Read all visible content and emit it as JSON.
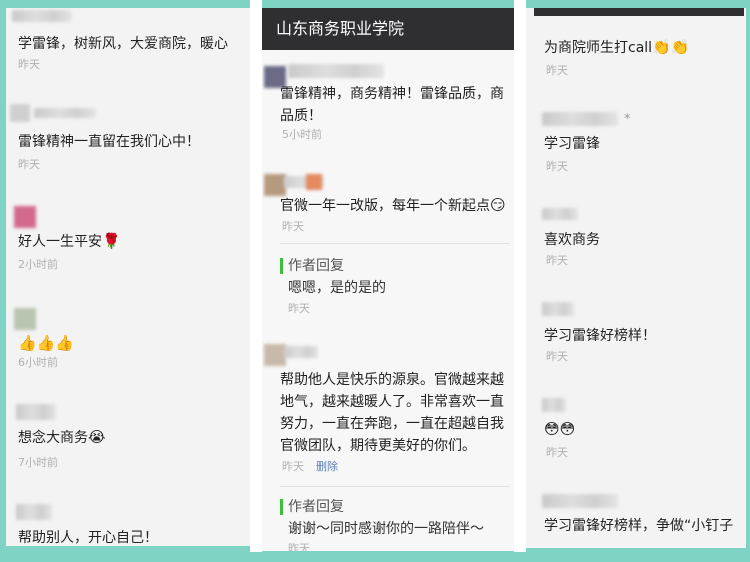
{
  "left_panel": {
    "comments": [
      {
        "text": "学雷锋，树新风，大爱商院，暖心",
        "time": "昨天"
      },
      {
        "text": "雷锋精神一直留在我们心中！",
        "time": "昨天"
      },
      {
        "text": "好人一生平安",
        "emoji": "🌹",
        "time": "2小时前"
      },
      {
        "text": "",
        "emoji": "👍👍👍",
        "time": "6小时前"
      },
      {
        "text": "想念大商务",
        "emoji": "😭",
        "time": "7小时前"
      },
      {
        "text": "帮助别人，开心自己！",
        "time": ""
      }
    ]
  },
  "middle_panel": {
    "title": "山东商务职业学院",
    "comments": [
      {
        "text_line1": "雷锋精神，商务精神！雷锋品质，商",
        "text_line2": "品质！",
        "time": "5小时前"
      },
      {
        "text": "官微一年一改版，每年一个新起点",
        "emoji": "😏",
        "time": "昨天"
      },
      {
        "text_line1": "帮助他人是快乐的源泉。官微越来越",
        "text_line2": "地气，越来越暖人了。非常喜欢一直",
        "text_line3": "努力，一直在奔跑，一直在超越自我",
        "text_line4": "官微团队，期待更美好的你们。",
        "time": "昨天",
        "delete_label": "删除"
      }
    ],
    "replies": [
      {
        "label": "作者回复",
        "text": "嗯嗯，是的是的",
        "time": "昨天"
      },
      {
        "label": "作者回复",
        "text": "谢谢～同时感谢你的一路陪伴～",
        "time": "昨天"
      }
    ]
  },
  "right_panel": {
    "comments": [
      {
        "text": "为商院师生打call",
        "emoji": "👏👏",
        "time": "昨天"
      },
      {
        "text": "学习雷锋",
        "time": "昨天",
        "name_suffix": "*"
      },
      {
        "text": "喜欢商务",
        "time": "昨天"
      },
      {
        "text": "学习雷锋好榜样！",
        "time": "昨天"
      },
      {
        "text": "",
        "emoji": "😳😳",
        "time": "昨天"
      },
      {
        "text": "学习雷锋好榜样，争做“小钉子",
        "time": ""
      }
    ]
  }
}
